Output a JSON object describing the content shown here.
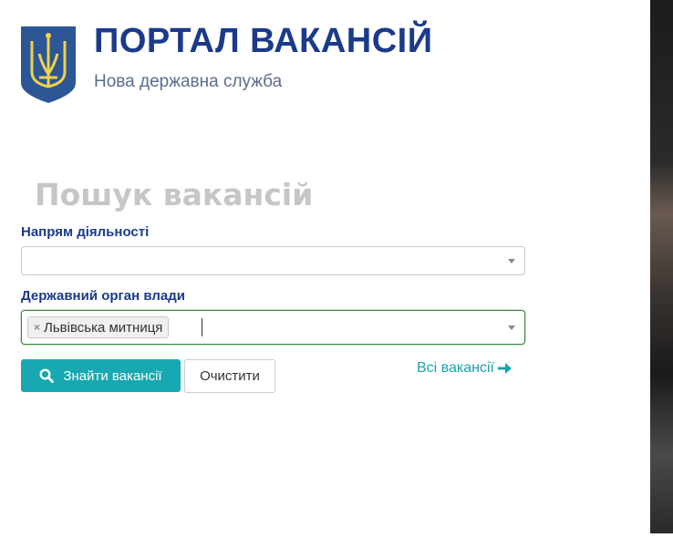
{
  "header": {
    "title": "ПОРТАЛ ВАКАНСІЙ",
    "subtitle": "Нова державна служба",
    "brand_color": "#1a3a8a"
  },
  "search": {
    "heading": "Пошук вакансій",
    "activity_label": "Напрям діяльності",
    "activity_value": "",
    "authority_label": "Державний орган влади",
    "authority_selected": [
      "Львівська митниця"
    ],
    "chip_remove_glyph": "×",
    "find_button_label": "Знайти вакансії",
    "clear_button_label": "Очистити",
    "all_vacancies_link": "Всі вакансії",
    "accent_color": "#17a8b2"
  },
  "icons": {
    "search": "search-icon",
    "arrow_right": "arrow-right-icon",
    "trident": "coat-of-arms-icon",
    "dropdown": "chevron-down-icon"
  }
}
